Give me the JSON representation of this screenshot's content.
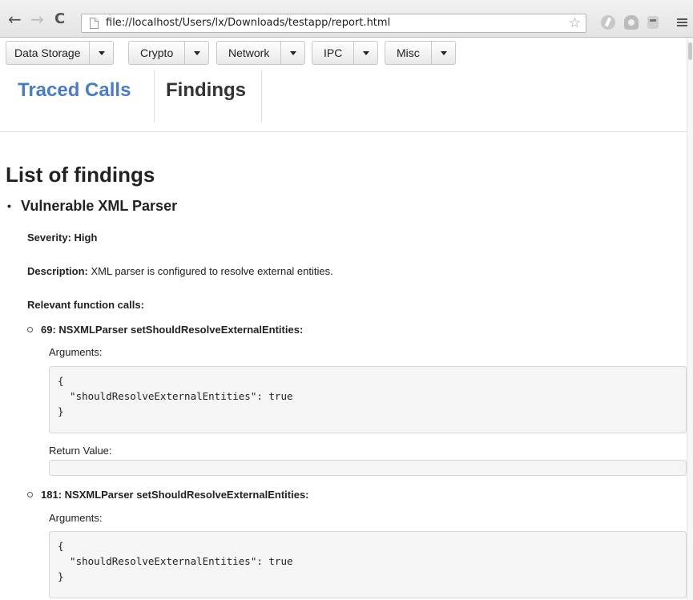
{
  "browser": {
    "back": "←",
    "forward": "→",
    "reload": "C",
    "url": "file://localhost/Users/lx/Downloads/testapp/report.html",
    "star": "☆"
  },
  "menus": [
    {
      "label": "Data Storage"
    },
    {
      "label": "Crypto"
    },
    {
      "label": "Network"
    },
    {
      "label": "IPC"
    },
    {
      "label": "Misc"
    }
  ],
  "tabs": {
    "traced": "Traced Calls",
    "findings": "Findings"
  },
  "main": {
    "heading": "List of findings",
    "finding": {
      "title": "Vulnerable XML Parser",
      "severity": "Severity: High",
      "description_label": "Description:",
      "description_text": " XML parser is configured to resolve external entities.",
      "relevant_label": "Relevant function calls:",
      "calls": [
        {
          "title": "69: NSXMLParser setShouldResolveExternalEntities:",
          "args_label": "Arguments:",
          "args_line1": "{",
          "args_line2": "  \"shouldResolveExternalEntities\": true",
          "args_line3": "}",
          "return_label": "Return Value:",
          "return_value": ""
        },
        {
          "title": "181: NSXMLParser setShouldResolveExternalEntities:",
          "args_label": "Arguments:",
          "args_line1": "{",
          "args_line2": "  \"shouldResolveExternalEntities\": true",
          "args_line3": "}"
        }
      ]
    }
  },
  "colors": {
    "accent": "#4a7cbf",
    "code_bg": "#f5f5f5"
  }
}
